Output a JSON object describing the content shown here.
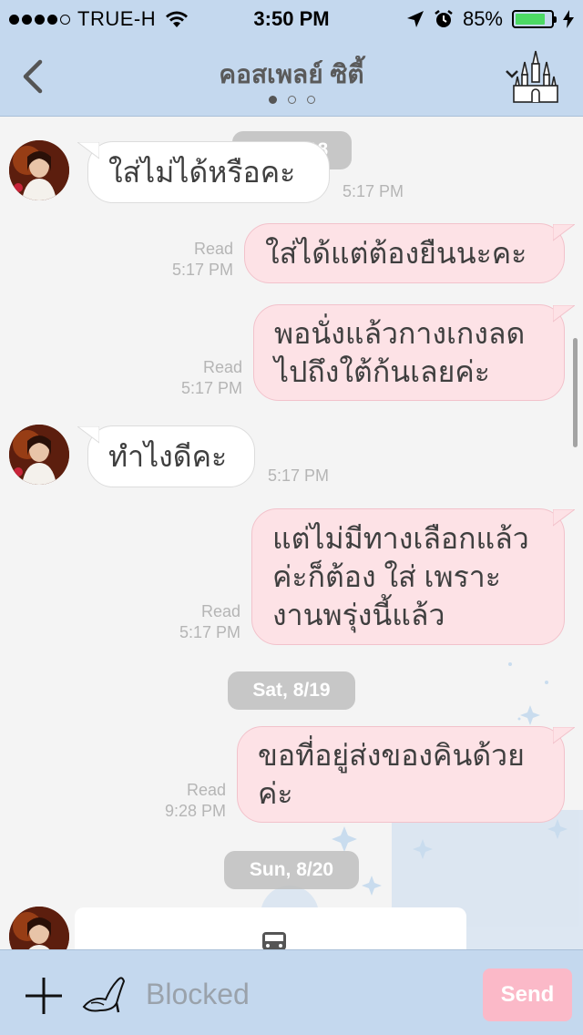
{
  "status_bar": {
    "carrier": "TRUE-H",
    "time": "3:50 PM",
    "battery_percent": "85%",
    "battery_level": 0.85,
    "icons": [
      "signal-dots-icon",
      "wifi-icon",
      "location-arrow-icon",
      "alarm-icon",
      "battery-icon",
      "charging-bolt-icon"
    ]
  },
  "header": {
    "title": "คอสเพลย์ ซิตี้",
    "page_count": 3,
    "active_page": 1
  },
  "messages": [
    {
      "date": "Fri, 8/18"
    },
    {
      "direction": "in",
      "text": "ใส่ไม่ได้หรือคะ",
      "time": "5:17 PM"
    },
    {
      "direction": "out",
      "text": "ใส่ได้แต่ต้องยืนนะคะ",
      "read": "Read",
      "time": "5:17 PM"
    },
    {
      "direction": "out",
      "text": "พอนั่งแล้วกางเกงลด\nไปถึงใต้ก้นเลยค่ะ",
      "read": "Read",
      "time": "5:17 PM"
    },
    {
      "direction": "in",
      "text": "ทำไงดีคะ",
      "time": "5:17 PM"
    },
    {
      "direction": "out",
      "text": "แต่ไม่มีทางเลือกแล้ว\nค่ะก็ต้อง ใส่ เพราะ\nงานพรุ่งนี้แล้ว",
      "read": "Read",
      "time": "5:17 PM"
    },
    {
      "date": "Sat, 8/19"
    },
    {
      "direction": "out",
      "text": "ขอที่อยู่ส่งของคินด้วย\nค่ะ",
      "read": "Read",
      "time": "9:28 PM"
    },
    {
      "date": "Sun, 8/20"
    }
  ],
  "input_bar": {
    "placeholder": "Blocked",
    "send_label": "Send"
  },
  "colors": {
    "header_bg": "#c4d8ee",
    "outgoing_bubble": "#fde2e6",
    "incoming_bubble": "#ffffff",
    "send_button": "#fbb9c8",
    "battery_green": "#4cd964"
  }
}
